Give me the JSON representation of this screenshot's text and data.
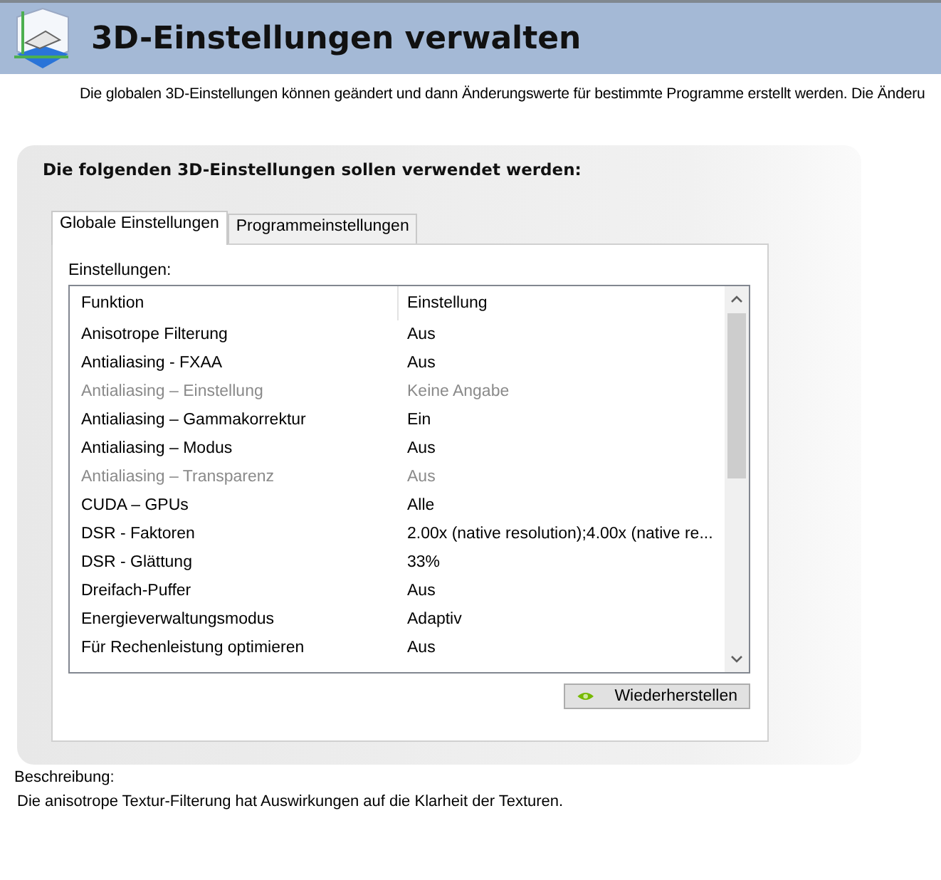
{
  "header": {
    "title": "3D-Einstellungen verwalten",
    "subtitle": "Die globalen 3D-Einstellungen können geändert und dann Änderungswerte für bestimmte Programme erstellt werden. Die Änderu"
  },
  "panel": {
    "heading": "Die folgenden 3D-Einstellungen sollen verwendet werden:",
    "tabs": [
      {
        "label": "Globale Einstellungen",
        "selected": true
      },
      {
        "label": "Programmeinstellungen",
        "selected": false
      }
    ],
    "settings_label": "Einstellungen:",
    "table": {
      "columns": [
        "Funktion",
        "Einstellung"
      ],
      "rows": [
        {
          "function": "Anisotrope Filterung",
          "setting": "Aus",
          "disabled": false
        },
        {
          "function": "Antialiasing - FXAA",
          "setting": "Aus",
          "disabled": false
        },
        {
          "function": "Antialiasing – Einstellung",
          "setting": "Keine Angabe",
          "disabled": true
        },
        {
          "function": "Antialiasing – Gammakorrektur",
          "setting": "Ein",
          "disabled": false
        },
        {
          "function": "Antialiasing – Modus",
          "setting": "Aus",
          "disabled": false
        },
        {
          "function": "Antialiasing – Transparenz",
          "setting": "Aus",
          "disabled": true
        },
        {
          "function": "CUDA – GPUs",
          "setting": "Alle",
          "disabled": false
        },
        {
          "function": "DSR - Faktoren",
          "setting": "2.00x (native resolution);4.00x (native re...",
          "disabled": false
        },
        {
          "function": "DSR - Glättung",
          "setting": "33%",
          "disabled": false
        },
        {
          "function": "Dreifach-Puffer",
          "setting": "Aus",
          "disabled": false
        },
        {
          "function": "Energieverwaltungsmodus",
          "setting": "Adaptiv",
          "disabled": false
        },
        {
          "function": "Für Rechenleistung optimieren",
          "setting": "Aus",
          "disabled": false
        }
      ]
    },
    "restore_button": "Wiederherstellen"
  },
  "description": {
    "label": "Beschreibung:",
    "text": "Die anisotrope Textur-Filterung hat Auswirkungen auf die Klarheit der Texturen."
  }
}
